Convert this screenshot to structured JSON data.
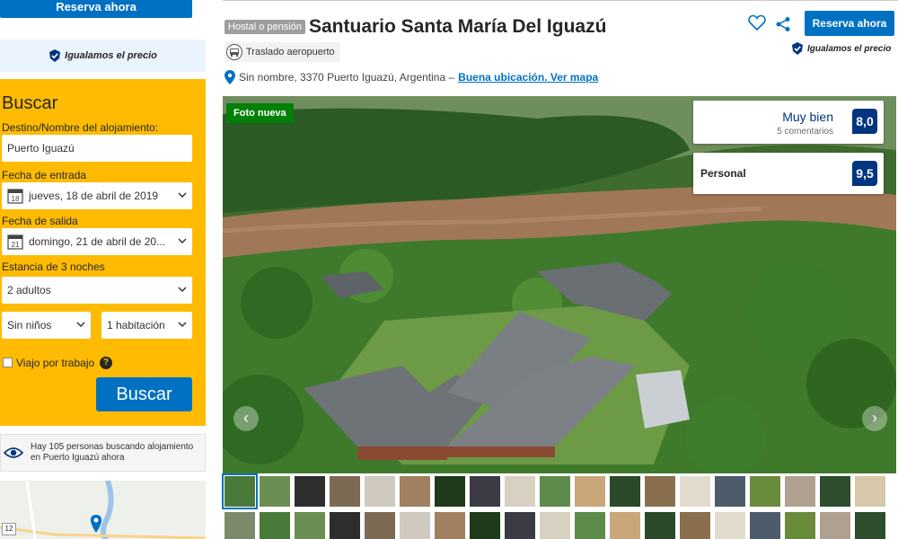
{
  "left": {
    "reserve_label": "Reserva ahora",
    "price_match": "Igualamos el precio",
    "search": {
      "title": "Buscar",
      "destination_label": "Destino/Nombre del alojamiento:",
      "destination_value": "Puerto Iguazú",
      "checkin_label": "Fecha de entrada",
      "checkin_day": "18",
      "checkin_value": "jueves, 18 de abril de 2019",
      "checkout_label": "Fecha de salida",
      "checkout_day": "21",
      "checkout_value": "domingo, 21 de abril de 20...",
      "stay_label": "Estancia de 3 noches",
      "adults_value": "2 adultos",
      "children_value": "Sin niños",
      "rooms_value": "1 habitación",
      "work_trip_label": "Viajo por trabajo",
      "help_symbol": "?",
      "button_label": "Buscar"
    },
    "people_searching": "Hay 105 personas buscando alojamiento en Puerto Iguazú ahora",
    "map_route_number": "12"
  },
  "header": {
    "type_badge": "Hostal o pensión",
    "hotel_name": "Santuario Santa María Del Iguazú",
    "reserve_label": "Reserva ahora",
    "price_match": "Igualamos el precio",
    "transfer_label": "Traslado aeropuerto",
    "address": "Sin nombre, 3370 Puerto Iguazú, Argentina –",
    "address_link": "Buena ubicación. Ver mapa"
  },
  "gallery": {
    "new_photo_label": "Foto nueva",
    "rating_word": "Muy bien",
    "rating_reviews": "5 comentarios",
    "rating_score": "8,0",
    "staff_label": "Personal",
    "staff_score": "9,5",
    "prev_arrow": "‹",
    "next_arrow": "›"
  },
  "colors": {
    "brand_blue": "#0071c2",
    "dark_blue": "#003580",
    "search_yellow": "#febb02",
    "new_photo_green": "#008009"
  },
  "icons": [
    "calendar-icon",
    "chevron-down-icon",
    "heart-icon",
    "share-icon",
    "shuttle-icon",
    "map-pin-icon",
    "eye-icon",
    "price-match-badge-icon",
    "help-icon"
  ]
}
